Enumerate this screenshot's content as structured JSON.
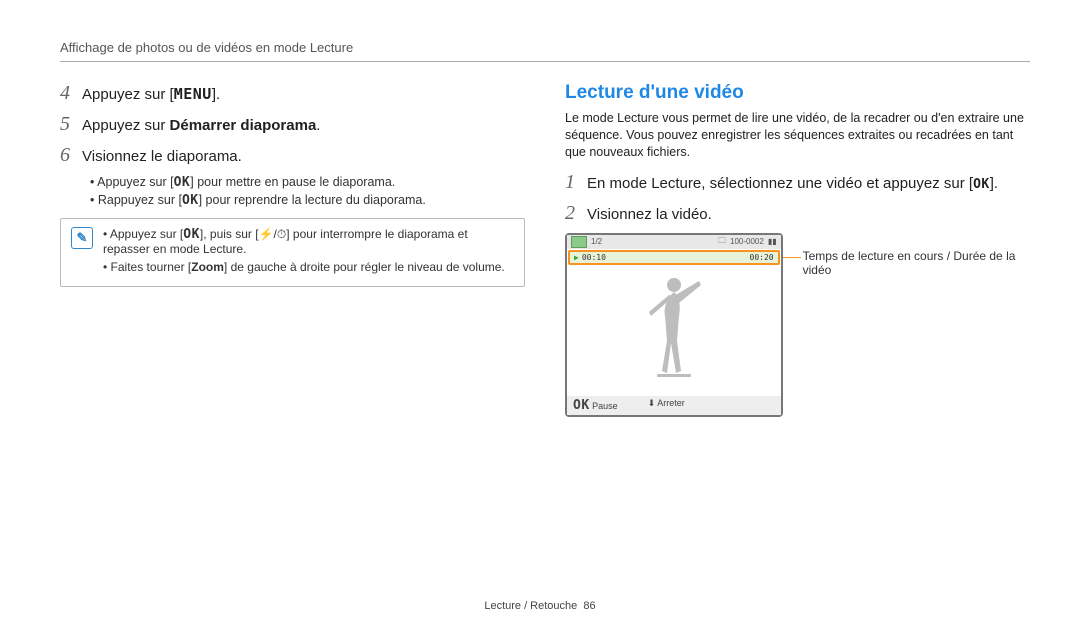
{
  "breadcrumb": "Affichage de photos ou de vidéos en mode Lecture",
  "left": {
    "steps": {
      "4": {
        "a": "Appuyez sur [",
        "menu": "MENU",
        "b": "]."
      },
      "5": {
        "a": "Appuyez sur ",
        "bold": "Démarrer diaporama",
        "b": "."
      },
      "6": "Visionnez le diaporama.",
      "sub1": {
        "a": "Appuyez sur [",
        "ok": "OK",
        "b": "] pour mettre en pause le diaporama."
      },
      "sub2": {
        "a": "Rappuyez sur [",
        "ok": "OK",
        "b": "] pour reprendre la lecture du diaporama."
      }
    },
    "note": {
      "line1": {
        "a": "Appuyez sur [",
        "ok": "OK",
        "mid": "], puis sur [",
        "flash": "⚡",
        "slash": "/",
        "timer": "⏱",
        "b": "] pour interrompre le diaporama et repasser en mode Lecture."
      },
      "line2": {
        "a": "Faites tourner [",
        "zoom": "Zoom",
        "b": "] de gauche à droite pour régler le niveau de volume."
      }
    }
  },
  "right": {
    "title": "Lecture d'une vidéo",
    "desc": "Le mode Lecture vous permet de lire une vidéo, de la recadrer ou d'en extraire une séquence. Vous pouvez enregistrer les séquences extraites ou recadrées en tant que nouveaux fichiers.",
    "steps": {
      "1": {
        "a": "En mode Lecture, sélectionnez une vidéo et appuyez sur [",
        "ok": "OK",
        "b": "]."
      },
      "2": "Visionnez la vidéo."
    },
    "video": {
      "top_counter": "1/2",
      "top_battery": "100-0002",
      "elapsed": "00:10",
      "total": "00:20",
      "pause": "Pause",
      "stop": "Arreter",
      "pause_icon": "OK"
    },
    "callout": "Temps de lecture en cours / Durée de la vidéo"
  },
  "footer": {
    "label": "Lecture / Retouche",
    "page": "86"
  }
}
